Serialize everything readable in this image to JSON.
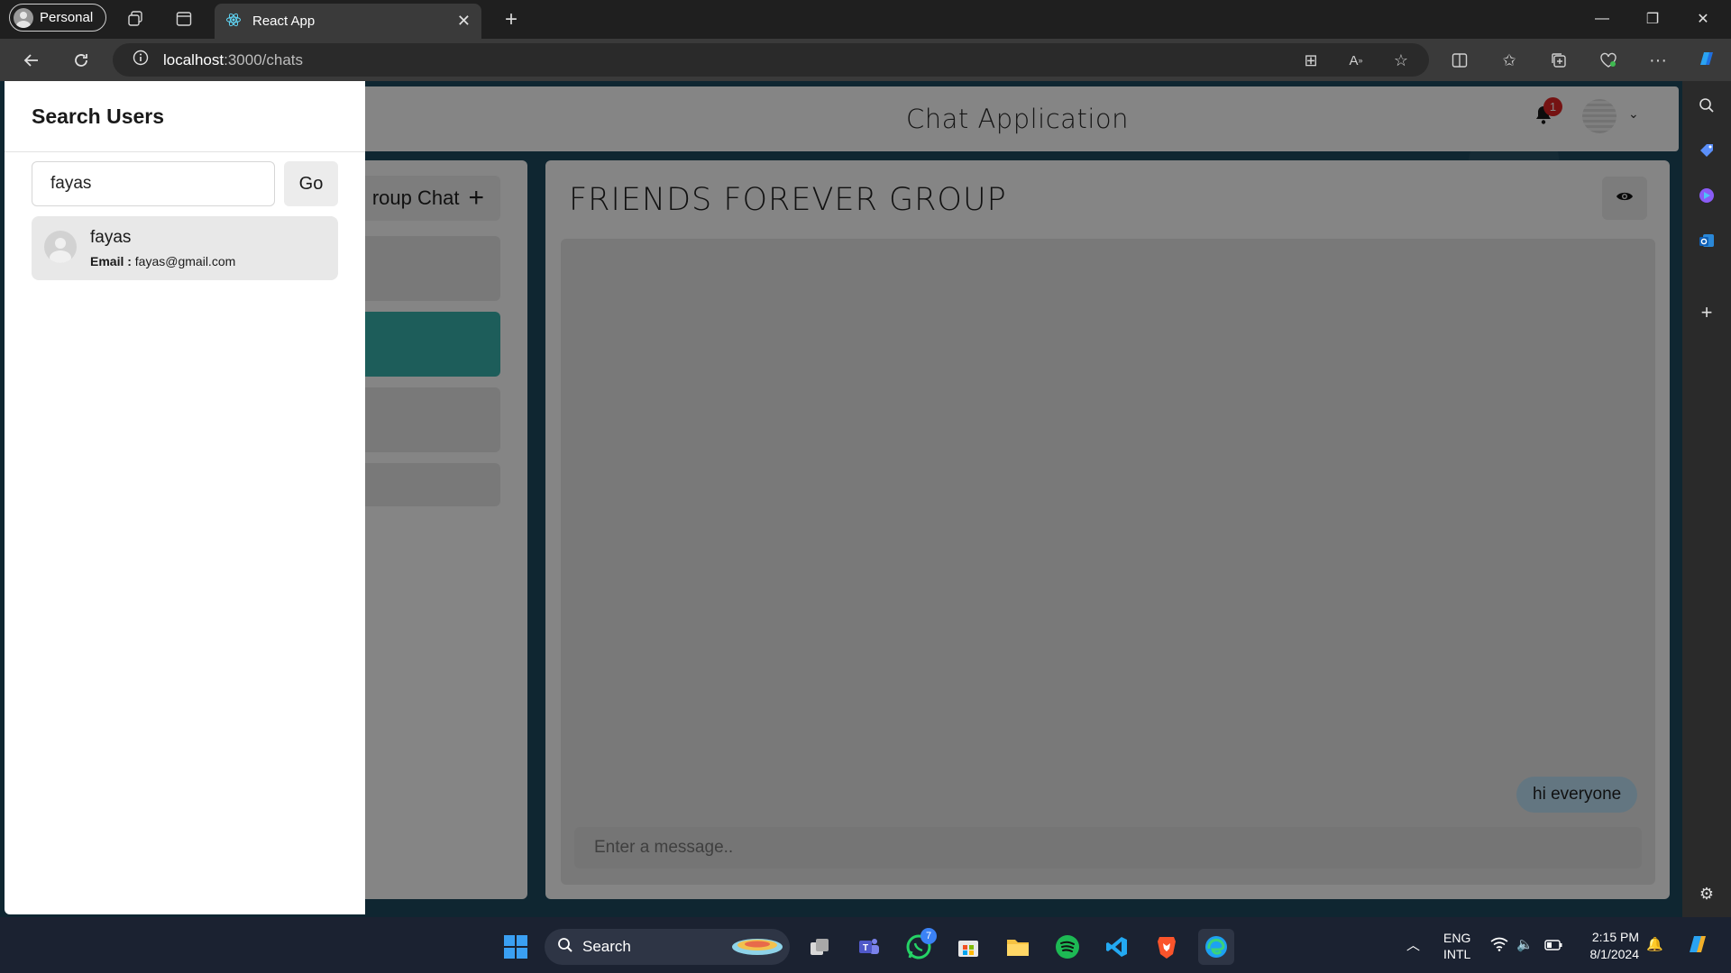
{
  "browser": {
    "profile_label": "Personal",
    "tab_title": "React App",
    "url_host": "localhost",
    "url_path": ":3000/chats"
  },
  "app": {
    "title": "Chat Application",
    "notification_count": "1",
    "new_group_label": "roup Chat",
    "chat_name": "FRIENDS FOREVER GROUP",
    "message_bubble": "hi everyone",
    "message_placeholder": "Enter a message.."
  },
  "drawer": {
    "title": "Search Users",
    "search_value": "fayas",
    "go_label": "Go",
    "results": [
      {
        "name": "fayas",
        "email_label": "Email :",
        "email": "fayas@gmail.com"
      }
    ]
  },
  "taskbar": {
    "search_label": "Search",
    "whatsapp_badge": "7",
    "lang_line1": "ENG",
    "lang_line2": "INTL",
    "time": "2:15 PM",
    "date": "8/1/2024"
  },
  "colors": {
    "accent_selected_chat": "#38b2ac",
    "notification_badge": "#e02424",
    "message_bubble": "#bee3f8"
  }
}
